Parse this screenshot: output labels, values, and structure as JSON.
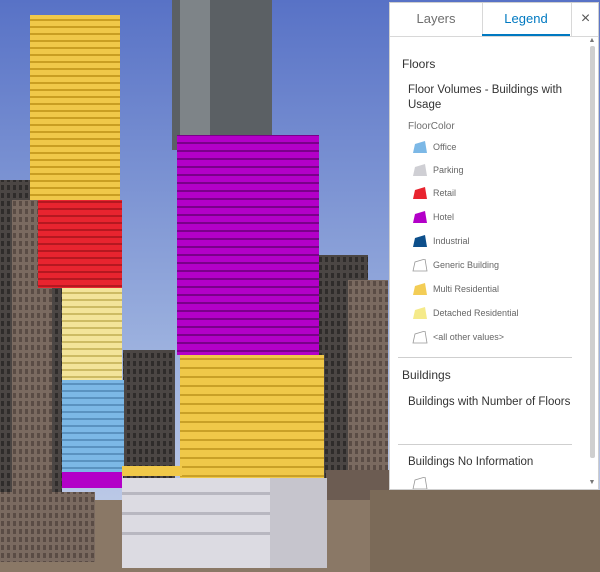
{
  "tabs": {
    "layers": "Layers",
    "legend": "Legend",
    "close": "×"
  },
  "legend": {
    "section1": "Floors",
    "layer1": "Floor Volumes - Buildings with Usage",
    "field": "FloorColor",
    "items": [
      {
        "label": "Office",
        "color": "#7cb8e6"
      },
      {
        "label": "Parking",
        "color": "#cfcfd4"
      },
      {
        "label": "Retail",
        "color": "#e8242f"
      },
      {
        "label": "Hotel",
        "color": "#b300c8"
      },
      {
        "label": "Industrial",
        "color": "#0d4f8b"
      },
      {
        "label": "Generic Building",
        "color": "#ffffff"
      },
      {
        "label": "Multi Residential",
        "color": "#f3cd56"
      },
      {
        "label": "Detached Residential",
        "color": "#f5ea8a"
      },
      {
        "label": "<all other values>",
        "color": "#ffffff"
      }
    ],
    "section2": "Buildings",
    "layer2": "Buildings with Number of Floors",
    "layer3": "Buildings No Information"
  }
}
